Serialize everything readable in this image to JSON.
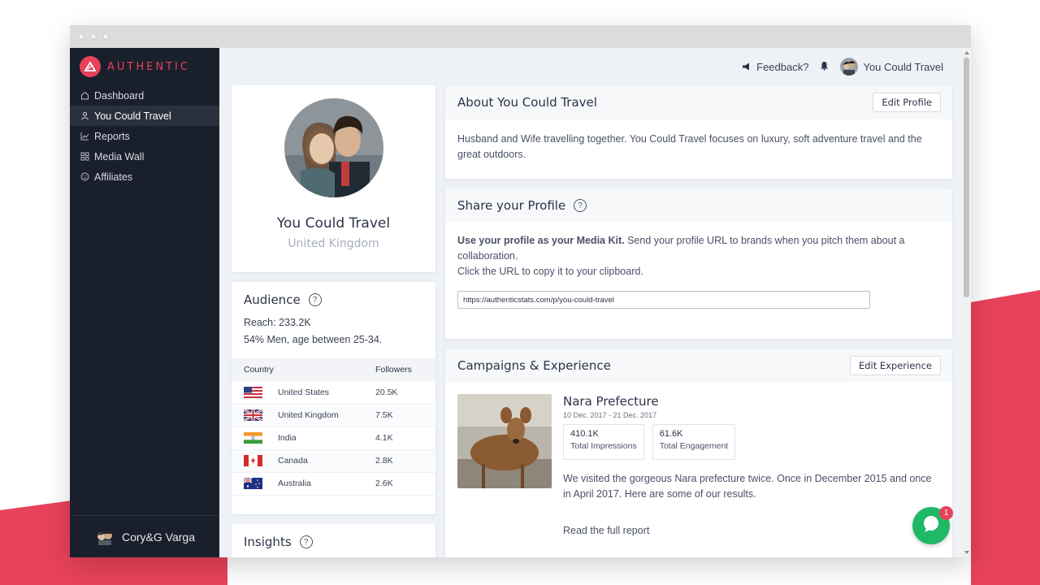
{
  "brand": {
    "name": "AUTHENTIC",
    "color": "#e8425a"
  },
  "sidebar": {
    "items": [
      {
        "label": "Dashboard",
        "icon": "home-icon",
        "active": false
      },
      {
        "label": "You Could Travel",
        "icon": "user-icon",
        "active": true
      },
      {
        "label": "Reports",
        "icon": "chart-icon",
        "active": false
      },
      {
        "label": "Media Wall",
        "icon": "grid-icon",
        "active": false
      },
      {
        "label": "Affiliates",
        "icon": "smile-icon",
        "active": false
      }
    ],
    "footer_user": "Cory&G Varga"
  },
  "topbar": {
    "feedback": "Feedback?",
    "user": "You Could Travel"
  },
  "profile": {
    "name": "You Could Travel",
    "location": "United Kingdom"
  },
  "audience": {
    "title": "Audience",
    "reach": "Reach: 233.2K",
    "demographics": "54% Men, age between 25-34.",
    "columns": [
      "Country",
      "Followers"
    ],
    "rows": [
      {
        "flag": "us-flag-icon",
        "country": "United States",
        "followers": "20.5K"
      },
      {
        "flag": "uk-flag-icon",
        "country": "United Kingdom",
        "followers": "7.5K"
      },
      {
        "flag": "india-flag-icon",
        "country": "India",
        "followers": "4.1K"
      },
      {
        "flag": "canada-flag-icon",
        "country": "Canada",
        "followers": "2.8K"
      },
      {
        "flag": "australia-flag-icon",
        "country": "Australia",
        "followers": "2.6K"
      }
    ]
  },
  "insights": {
    "title": "Insights"
  },
  "about": {
    "title": "About You Could Travel",
    "edit_label": "Edit Profile",
    "text": "Husband and Wife travelling together. You Could Travel focuses on luxury, soft adventure travel and the great outdoors."
  },
  "share": {
    "title": "Share your Profile",
    "lead_bold": "Use your profile as your Media Kit.",
    "lead_rest": " Send your profile URL to brands when you pitch them about a collaboration.",
    "hint": "Click the URL to copy it to your clipboard.",
    "url": "https://authenticstats.com/p/you-could-travel"
  },
  "campaigns": {
    "title": "Campaigns & Experience",
    "edit_label": "Edit Experience",
    "item": {
      "title": "Nara Prefecture",
      "dates": "10 Dec. 2017 - 21 Dec. 2017",
      "stats": [
        {
          "value": "410.1K",
          "label": "Total Impressions"
        },
        {
          "value": "61.6K",
          "label": "Total Engagement"
        }
      ],
      "description": "We visited the gorgeous Nara prefecture twice. Once in December 2015 and once in April 2017. Here are some of our results.",
      "link": "Read the full report"
    }
  },
  "chat": {
    "badge": "1",
    "color": "#1fb865"
  }
}
